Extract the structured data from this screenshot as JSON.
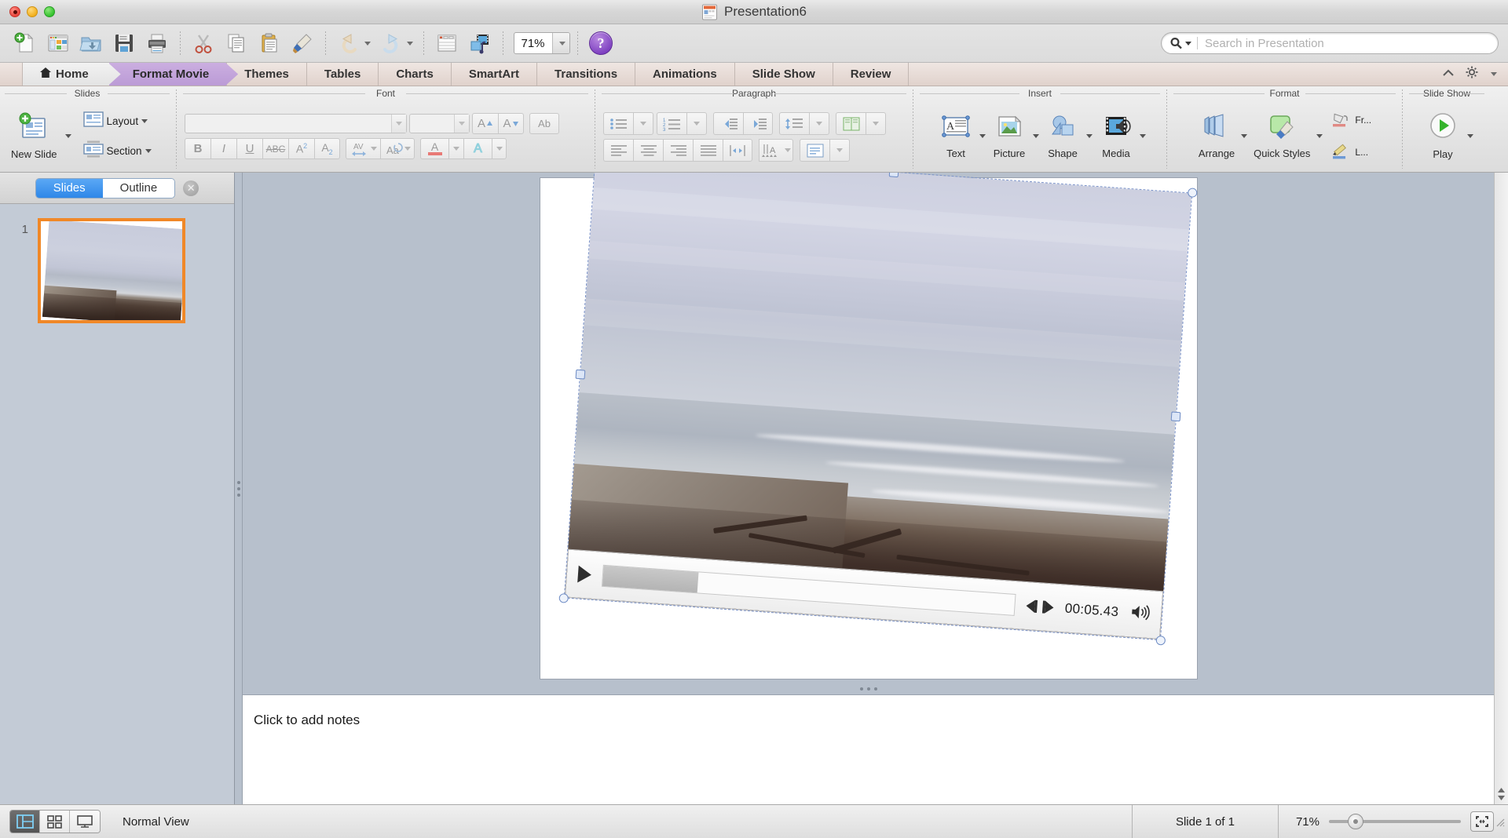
{
  "window": {
    "title": "Presentation6",
    "doc_icon": "powerpoint-document-icon",
    "traffic_lights": [
      "close",
      "minimize",
      "zoom"
    ]
  },
  "toolbar": {
    "items": [
      {
        "name": "new-presentation-icon",
        "tip": "New"
      },
      {
        "name": "new-from-template-icon",
        "tip": "New from template"
      },
      {
        "name": "open-folder-icon",
        "tip": "Open"
      },
      {
        "name": "save-icon",
        "tip": "Save"
      },
      {
        "name": "print-icon",
        "tip": "Print"
      },
      {
        "name": "cut-scissors-icon",
        "tip": "Cut"
      },
      {
        "name": "copy-icon",
        "tip": "Copy"
      },
      {
        "name": "paste-clipboard-icon",
        "tip": "Paste"
      },
      {
        "name": "format-painter-icon",
        "tip": "Format"
      },
      {
        "name": "undo-icon",
        "tip": "Undo"
      },
      {
        "name": "redo-icon",
        "tip": "Redo"
      },
      {
        "name": "table-icon",
        "tip": "Table"
      },
      {
        "name": "media-browser-icon",
        "tip": "Media Browser"
      }
    ],
    "zoom_value": "71%",
    "help_label": "?"
  },
  "search": {
    "placeholder": "Search in Presentation",
    "icon": "search-icon"
  },
  "ribbon_tabs": [
    {
      "label": "Home",
      "state": "home",
      "icon": "home-icon"
    },
    {
      "label": "Format Movie",
      "state": "active"
    },
    {
      "label": "Themes",
      "state": "normal"
    },
    {
      "label": "Tables",
      "state": "normal"
    },
    {
      "label": "Charts",
      "state": "normal"
    },
    {
      "label": "SmartArt",
      "state": "normal"
    },
    {
      "label": "Transitions",
      "state": "normal"
    },
    {
      "label": "Animations",
      "state": "normal"
    },
    {
      "label": "Slide Show",
      "state": "normal"
    },
    {
      "label": "Review",
      "state": "normal"
    }
  ],
  "ribbon": {
    "groups": {
      "slides": {
        "title": "Slides",
        "new_slide": "New Slide",
        "layout": "Layout",
        "section": "Section"
      },
      "font": {
        "title": "Font",
        "font_name_value": "",
        "font_size_value": "",
        "grow_label": "A",
        "shrink_label": "A",
        "clear_label": "Ab",
        "bold": "B",
        "italic": "I",
        "underline": "U",
        "strikethrough": "ABC",
        "superscript": "A2",
        "subscript": "A2",
        "spacing": "AV",
        "case": "Aa",
        "font_color": "A",
        "text_effects": "A"
      },
      "paragraph": {
        "title": "Paragraph",
        "buttons": [
          "bullets",
          "numbering",
          "decrease-indent",
          "increase-indent",
          "line-spacing",
          "columns",
          "align-left",
          "align-center",
          "align-right",
          "justify",
          "adjust-spacing",
          "text-direction",
          "align-text"
        ]
      },
      "insert": {
        "title": "Insert",
        "text": "Text",
        "picture": "Picture",
        "shape": "Shape",
        "media": "Media"
      },
      "format": {
        "title": "Format",
        "arrange": "Arrange",
        "quick_styles": "Quick Styles",
        "fill": "Fr...",
        "line": "L..."
      },
      "slideshow": {
        "title": "Slide Show",
        "play": "Play"
      }
    }
  },
  "left_pane": {
    "tab_slides": "Slides",
    "tab_outline": "Outline",
    "active_tab": "Slides",
    "close_icon": "close-icon",
    "slides": [
      {
        "number": "1",
        "selected": true,
        "content": "beach-video-thumbnail"
      }
    ]
  },
  "slide": {
    "movie": {
      "selected": true,
      "rotation_deg": 4,
      "content": "beach-ocean-driftwood-video",
      "player": {
        "play_icon": "play-icon",
        "timecode": "00:05.43",
        "step_back_icon": "step-backward-icon",
        "step_forward_icon": "step-forward-icon",
        "volume_icon": "volume-icon",
        "progress_percent": 23
      },
      "handles": [
        "rotate",
        "top-left",
        "top-center",
        "top-right",
        "middle-left",
        "middle-right",
        "bottom-left",
        "bottom-right"
      ]
    }
  },
  "notes": {
    "placeholder": "Click to add notes"
  },
  "status_bar": {
    "view_buttons": [
      {
        "name": "normal-view-button",
        "active": true
      },
      {
        "name": "slide-sorter-button",
        "active": false
      },
      {
        "name": "presenter-view-button",
        "active": false
      }
    ],
    "view_name": "Normal View",
    "slide_count": "Slide 1 of 1",
    "zoom_percent": "71%",
    "fit_icon": "fit-to-window-icon"
  },
  "colors": {
    "active_tab": "#bb9bd6",
    "selection_orange": "#f08828",
    "segment_blue": "#2e87e8",
    "handle_blue": "#6d8bc4",
    "rotate_green": "#5fbf4a",
    "canvas_bg": "#b7c0cc"
  }
}
